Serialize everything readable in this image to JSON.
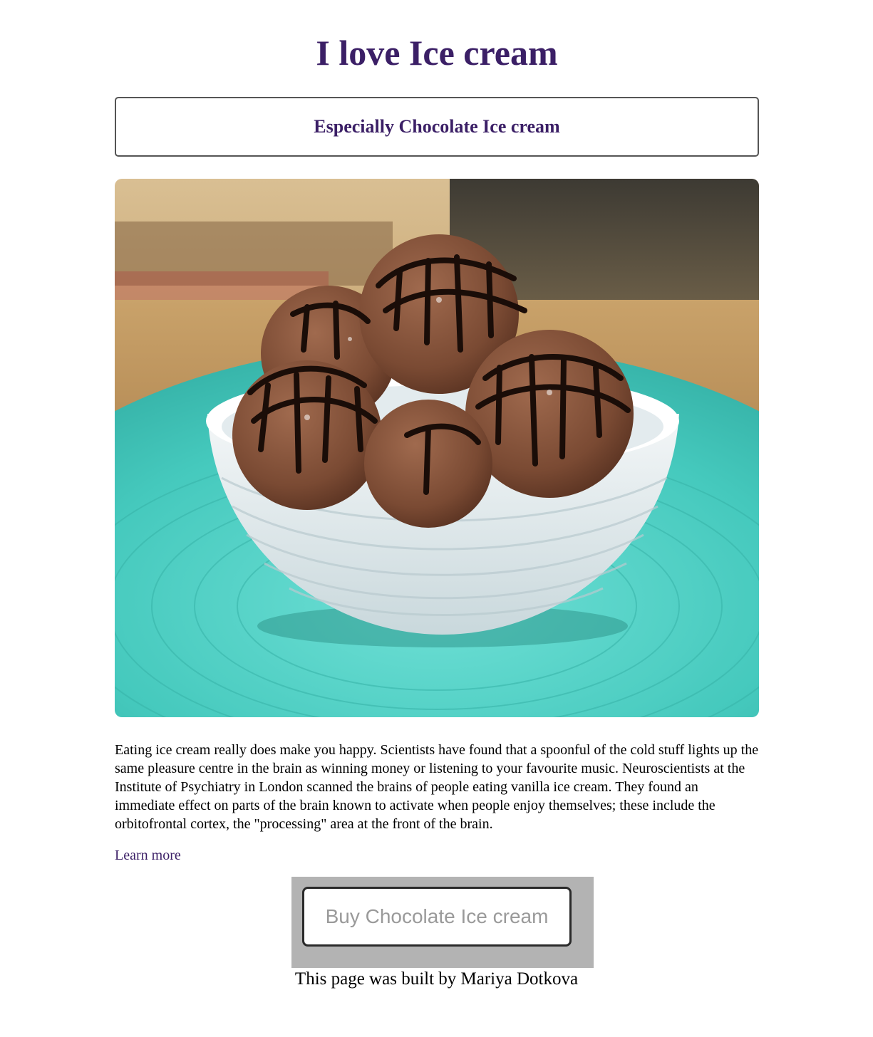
{
  "header": {
    "title": "I love Ice cream",
    "subtitle": "Especially Chocolate Ice cream"
  },
  "image": {
    "alt": "Bowl of chocolate ice cream scoops drizzled with chocolate sauce on a turquoise placemat"
  },
  "content": {
    "paragraph": "Eating ice cream really does make you happy. Scientists have found that a spoonful of the cold stuff lights up the same pleasure centre in the brain as winning money or listening to your favourite music. Neuroscientists at the Institute of Psychiatry in London scanned the brains of people eating vanilla ice cream. They found an immediate effect on parts of the brain known to activate when people enjoy themselves; these include the orbitofrontal cortex, the \"processing\" area at the front of the brain.",
    "learn_more": "Learn more"
  },
  "actions": {
    "buy_label": "Buy Chocolate Ice cream"
  },
  "footer": {
    "text": "This page was built by Mariya Dotkova"
  },
  "colors": {
    "heading": "#3b1f66",
    "button_bg": "#b3b3b3",
    "button_text": "#9a9a9a"
  }
}
